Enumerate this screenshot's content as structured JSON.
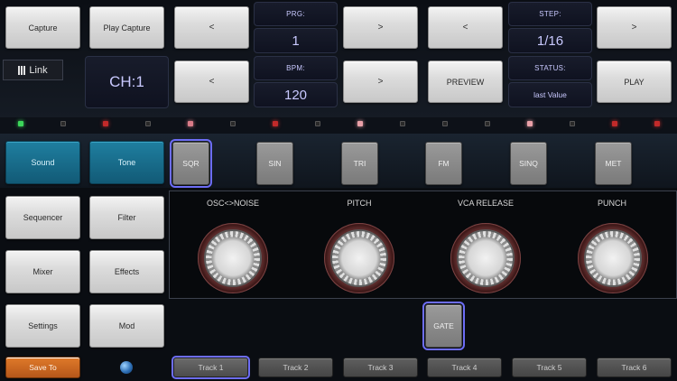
{
  "header": {
    "capture_label": "Capture",
    "play_capture_label": "Play Capture",
    "link_label": "Link",
    "channel_label": "CH:1",
    "arrow_left": "<",
    "arrow_right": ">",
    "prg": {
      "label": "PRG:",
      "value": "1"
    },
    "bpm": {
      "label": "BPM:",
      "value": "120"
    },
    "step": {
      "label": "STEP:",
      "value": "1/16"
    },
    "status": {
      "label": "STATUS:",
      "value": "last Value"
    },
    "preview_label": "PREVIEW",
    "play_label": "PLAY"
  },
  "leds": [
    {
      "color": "#3cd65a"
    },
    {
      "color": "#2a2a2a"
    },
    {
      "color": "#c22a2a"
    },
    {
      "color": "#2a2a2a"
    },
    {
      "color": "#d97b88"
    },
    {
      "color": "#2a2a2a"
    },
    {
      "color": "#c22a2a"
    },
    {
      "color": "#2a2a2a"
    },
    {
      "color": "#e9a0a8"
    },
    {
      "color": "#2a2a2a"
    },
    {
      "color": "#2a2a2a"
    },
    {
      "color": "#2a2a2a"
    },
    {
      "color": "#e9a0a8"
    },
    {
      "color": "#2a2a2a"
    },
    {
      "color": "#c22a2a"
    },
    {
      "color": "#c22a2a"
    }
  ],
  "sidebar": {
    "sound_label": "Sound",
    "tone_label": "Tone",
    "sequencer_label": "Sequencer",
    "filter_label": "Filter",
    "mixer_label": "Mixer",
    "effects_label": "Effects",
    "settings_label": "Settings",
    "mod_label": "Mod",
    "save_label": "Save To"
  },
  "waveforms": [
    "SQR",
    "SIN",
    "TRI",
    "FM",
    "SINQ",
    "MET"
  ],
  "selected_waveform": "SQR",
  "params": [
    "OSC<>NOISE",
    "PITCH",
    "VCA RELEASE",
    "PUNCH"
  ],
  "gate_label": "GATE",
  "tracks": [
    "Track 1",
    "Track 2",
    "Track 3",
    "Track 4",
    "Track 5",
    "Track 6"
  ],
  "selected_track": "Track 1",
  "colors": {
    "accent_purple": "#6d6df5",
    "lcd_text": "#c9c9ff",
    "blue_button": "#1f7fa0",
    "orange_button": "#e07a2a"
  }
}
